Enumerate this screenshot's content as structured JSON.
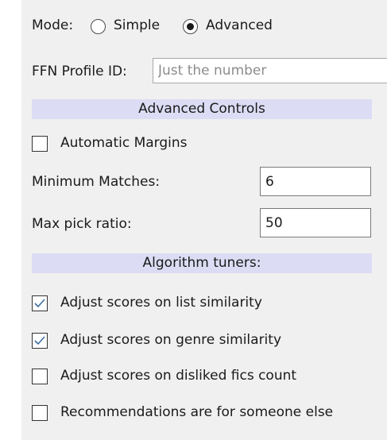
{
  "mode": {
    "label": "Mode:",
    "options": [
      {
        "label": "Simple",
        "selected": false
      },
      {
        "label": "Advanced",
        "selected": true
      }
    ]
  },
  "profile": {
    "label": "FFN Profile ID:",
    "value": "",
    "placeholder": "Just the number"
  },
  "advanced_controls": {
    "title": "Advanced Controls",
    "automatic_margins": {
      "label": "Automatic Margins",
      "checked": false
    },
    "minimum_matches": {
      "label": "Minimum Matches:",
      "value": "6"
    },
    "max_pick_ratio": {
      "label": "Max pick ratio:",
      "value": "50"
    }
  },
  "algorithm_tuners": {
    "title": "Algorithm tuners:",
    "options": [
      {
        "label": "Adjust scores on list similarity",
        "checked": true
      },
      {
        "label": "Adjust scores on genre similarity",
        "checked": true
      },
      {
        "label": "Adjust scores on disliked fics count",
        "checked": false
      },
      {
        "label": "Recommendations are for someone else",
        "checked": false
      }
    ]
  },
  "colors": {
    "panel_background": "#f0f0f0",
    "section_header": "#dcdcf4",
    "checkmark": "#3c6ea5"
  }
}
